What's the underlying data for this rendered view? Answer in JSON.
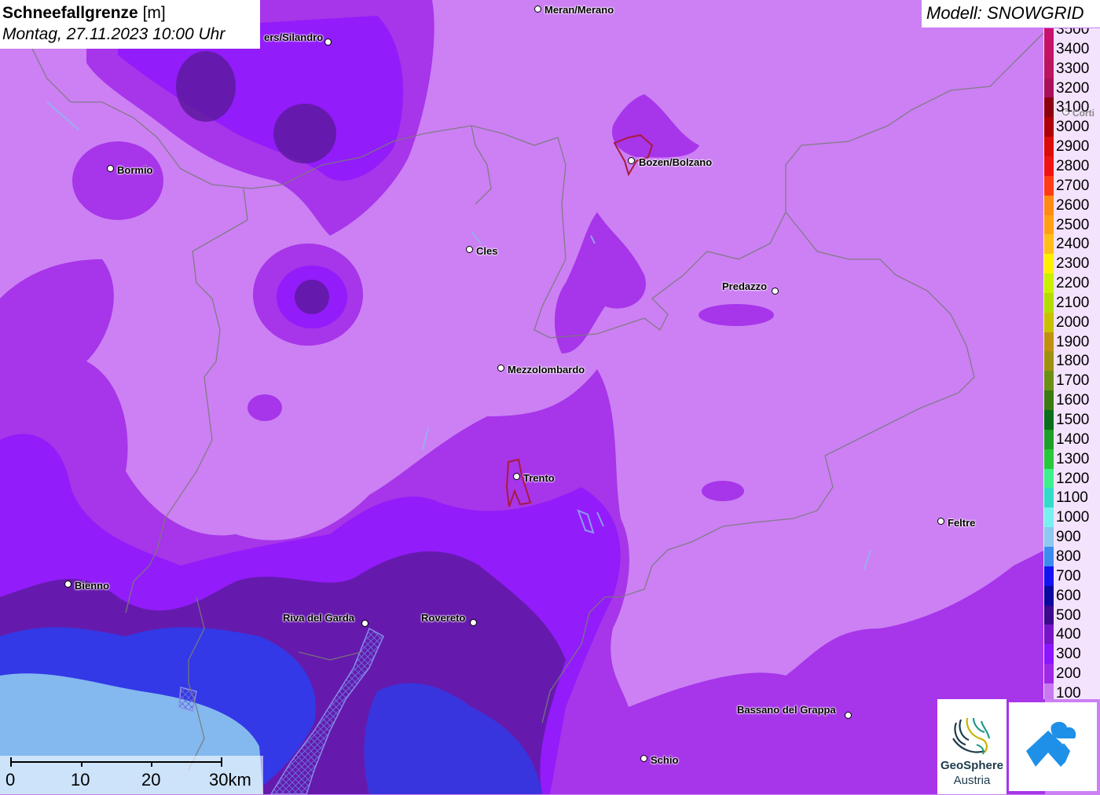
{
  "header": {
    "title_bold": "Schneefallgrenze",
    "title_unit": "[m]",
    "datetime": "Montag, 27.11.2023 10:00 Uhr",
    "model": "Modell: SNOWGRID"
  },
  "legend": [
    {
      "label": "3500",
      "color": "#c8106e"
    },
    {
      "label": "3400",
      "color": "#c51266"
    },
    {
      "label": "3300",
      "color": "#bb1560"
    },
    {
      "label": "3200",
      "color": "#a8105c"
    },
    {
      "label": "3100",
      "color": "#8e0010"
    },
    {
      "label": "3000",
      "color": "#b0000a"
    },
    {
      "label": "2900",
      "color": "#dc0a0a"
    },
    {
      "label": "2800",
      "color": "#ef1414"
    },
    {
      "label": "2700",
      "color": "#ff3c14"
    },
    {
      "label": "2600",
      "color": "#ff8a14"
    },
    {
      "label": "2500",
      "color": "#ffa014"
    },
    {
      "label": "2400",
      "color": "#ffbe1a"
    },
    {
      "label": "2300",
      "color": "#fff000"
    },
    {
      "label": "2200",
      "color": "#c8f000"
    },
    {
      "label": "2100",
      "color": "#b4dc00"
    },
    {
      "label": "2000",
      "color": "#c8c000"
    },
    {
      "label": "1900",
      "color": "#c09010"
    },
    {
      "label": "1800",
      "color": "#a09010"
    },
    {
      "label": "1700",
      "color": "#6c9014"
    },
    {
      "label": "1600",
      "color": "#3c7a14"
    },
    {
      "label": "1500",
      "color": "#0a6e1e"
    },
    {
      "label": "1400",
      "color": "#1ea028"
    },
    {
      "label": "1300",
      "color": "#28c83c"
    },
    {
      "label": "1200",
      "color": "#3cf08c"
    },
    {
      "label": "1100",
      "color": "#32dcc8"
    },
    {
      "label": "1000",
      "color": "#78f0f0"
    },
    {
      "label": "900",
      "color": "#8cc8f0"
    },
    {
      "label": "800",
      "color": "#3c8cf0"
    },
    {
      "label": "700",
      "color": "#1414f0"
    },
    {
      "label": "600",
      "color": "#0a0aa0"
    },
    {
      "label": "500",
      "color": "#3c0a8c"
    },
    {
      "label": "400",
      "color": "#7814c8"
    },
    {
      "label": "300",
      "color": "#8c14ff"
    },
    {
      "label": "200",
      "color": "#a028e6"
    },
    {
      "label": "100",
      "color": "#c878f0"
    }
  ],
  "cities": [
    {
      "name": "Meran/Merano"
    },
    {
      "name": "ers/Silandro"
    },
    {
      "name": "Bormio"
    },
    {
      "name": "Bozen/Bolzano"
    },
    {
      "name": "Cles"
    },
    {
      "name": "Predazzo"
    },
    {
      "name": "Mezzolombardo"
    },
    {
      "name": "Trento"
    },
    {
      "name": "Feltre"
    },
    {
      "name": "Bienno"
    },
    {
      "name": "Riva del Garda"
    },
    {
      "name": "Rovereto"
    },
    {
      "name": "Bassano del Grappa"
    },
    {
      "name": "Schio"
    },
    {
      "name": "Corti"
    }
  ],
  "scale": {
    "labels": [
      "0",
      "10",
      "20",
      "30km"
    ]
  },
  "logos": {
    "geosphere_name": "GeoSphere",
    "geosphere_country": "Austria"
  },
  "colors": {
    "base": "#cc80f4",
    "level_200": "#a028e6",
    "level_300": "#8c14ff",
    "level_500": "#5a1a9a",
    "level_700": "#2a3ff0",
    "level_900": "#8cc8f0",
    "border": "#7a7a7a"
  }
}
